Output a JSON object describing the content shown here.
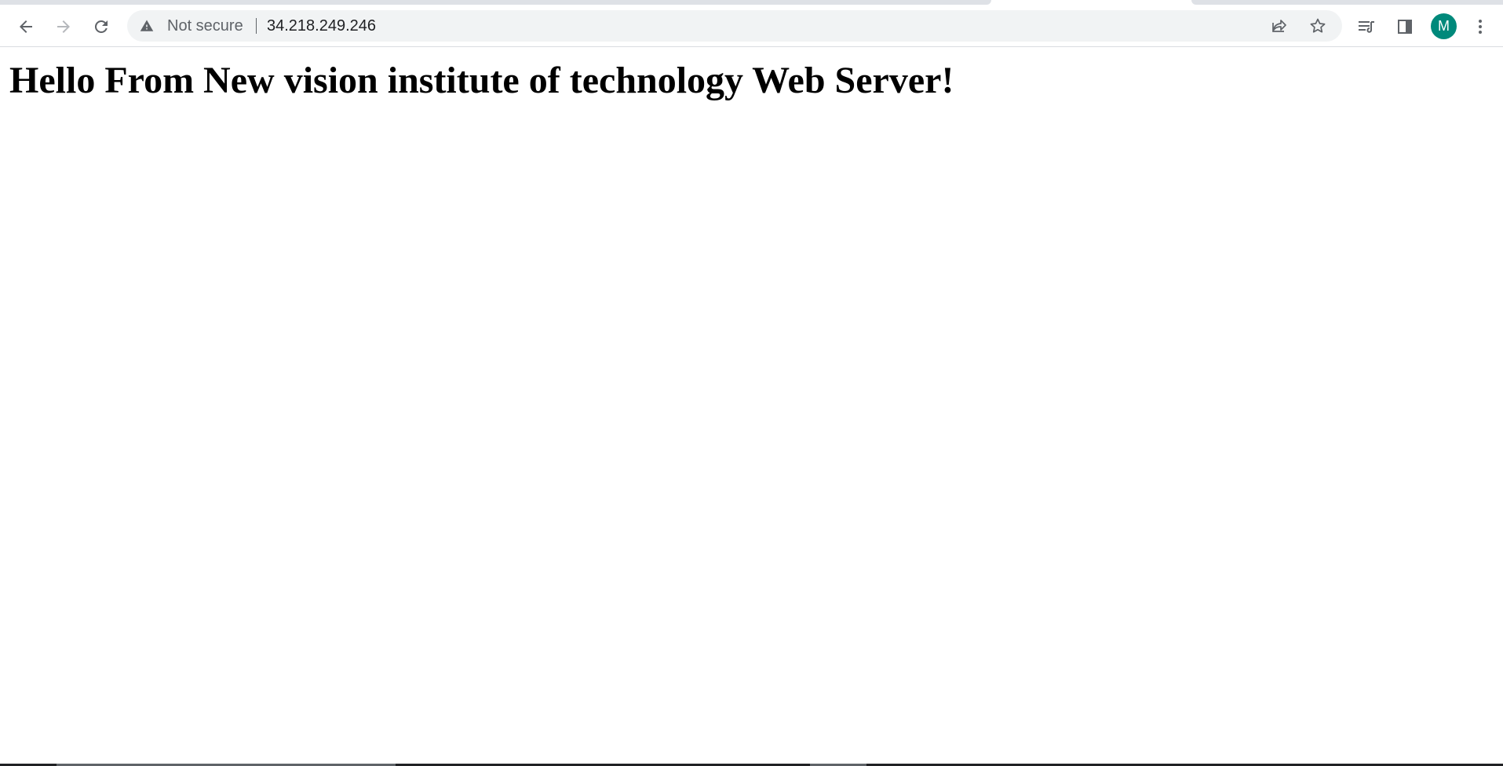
{
  "browser": {
    "toolbar": {
      "back_label": "Back",
      "forward_label": "Forward",
      "reload_label": "Reload"
    },
    "omnibox": {
      "security_status": "Not secure",
      "url": "34.218.249.246"
    },
    "profile": {
      "avatar_letter": "M",
      "avatar_color": "#00897b"
    },
    "icons": [
      "back-arrow-icon",
      "forward-arrow-icon",
      "reload-icon",
      "warning-icon",
      "share-icon",
      "star-icon",
      "reading-list-icon",
      "side-panel-icon",
      "more-vert-icon"
    ]
  },
  "page": {
    "heading": "Hello From New vision institute of technology Web Server!"
  }
}
